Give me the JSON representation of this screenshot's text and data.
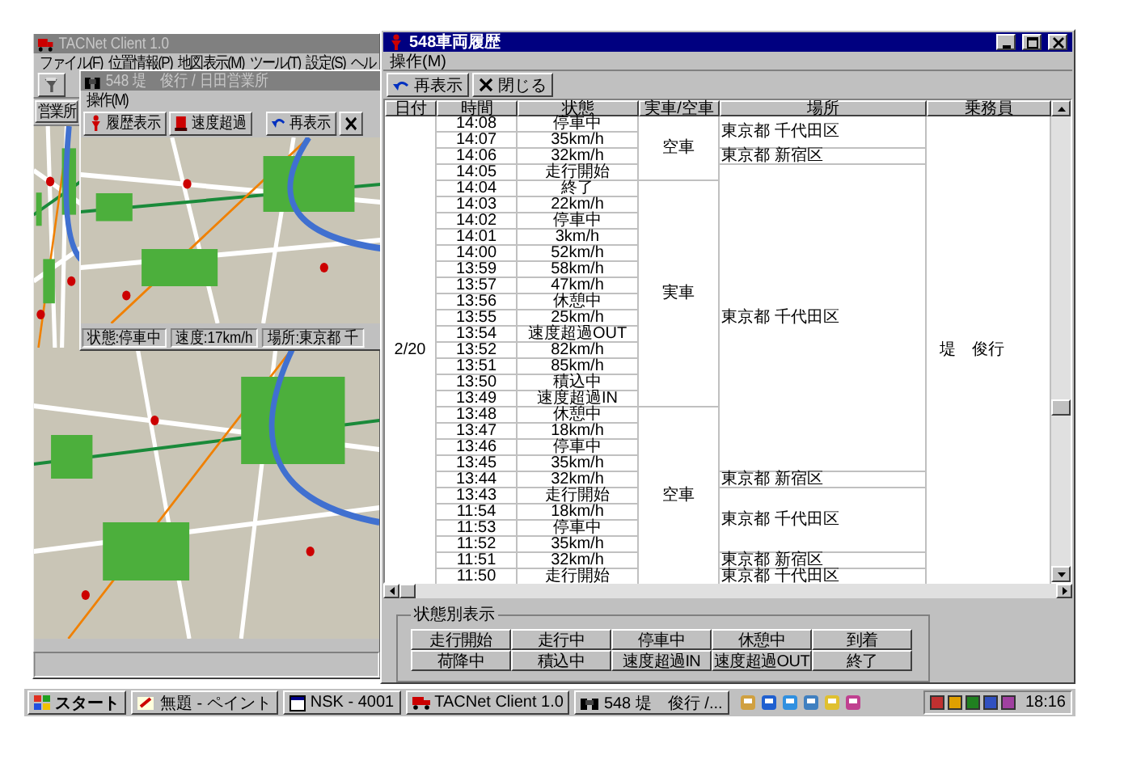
{
  "background_window": {
    "title": "TACNet Client 1.0",
    "menu": [
      "ファイル(F)",
      "位置情報(P)",
      "地図表示(M)",
      "ツール(T)",
      "設定(S)",
      "ヘル"
    ],
    "office_tab": "営業所",
    "vehicle_window": {
      "title": "548 堤　俊行 / 日田営業所",
      "menu": [
        "操作(M)"
      ],
      "toolbar": [
        {
          "kind": "history",
          "label": "履歴表示"
        },
        {
          "kind": "speed",
          "label": "速度超過"
        },
        {
          "kind": "refresh",
          "label": "再表示"
        },
        {
          "kind": "close"
        }
      ],
      "status_bar": [
        "状態:停車中",
        "速度:17km/h",
        "場所:東京都 千"
      ]
    }
  },
  "window": {
    "title": "548車両履歴",
    "menu": [
      "操作(M)"
    ],
    "toolbar": [
      {
        "kind": "refresh",
        "label": "再表示"
      },
      {
        "kind": "close",
        "label": "閉じる"
      }
    ]
  },
  "table": {
    "columns": [
      "日付",
      "時間",
      "状態",
      "実車/空車",
      "場所",
      "乗務員"
    ],
    "rows": [
      {
        "time": "14:08",
        "status": "停車中",
        "date": "2/20",
        "vehicle": "空車",
        "location": "東京都 千代田区",
        "crew": "堤　俊行"
      },
      {
        "time": "14:07",
        "status": "35km/h"
      },
      {
        "time": "14:06",
        "status": "32km/h",
        "location": "東京都 新宿区"
      },
      {
        "time": "14:05",
        "status": "走行開始",
        "location": "東京都 千代田区"
      },
      {
        "time": "14:04",
        "status": "終了",
        "vehicle": "実車"
      },
      {
        "time": "14:03",
        "status": "22km/h"
      },
      {
        "time": "14:02",
        "status": "停車中"
      },
      {
        "time": "14:01",
        "status": "3km/h"
      },
      {
        "time": "14:00",
        "status": "52km/h"
      },
      {
        "time": "13:59",
        "status": "58km/h"
      },
      {
        "time": "13:57",
        "status": "47km/h"
      },
      {
        "time": "13:56",
        "status": "休憩中"
      },
      {
        "time": "13:55",
        "status": "25km/h"
      },
      {
        "time": "13:54",
        "status": "速度超過OUT"
      },
      {
        "time": "13:52",
        "status": "82km/h"
      },
      {
        "time": "13:51",
        "status": "85km/h"
      },
      {
        "time": "13:50",
        "status": "積込中"
      },
      {
        "time": "13:49",
        "status": "速度超過IN"
      },
      {
        "time": "13:48",
        "status": "休憩中",
        "vehicle": "空車"
      },
      {
        "time": "13:47",
        "status": "18km/h"
      },
      {
        "time": "13:46",
        "status": "停車中"
      },
      {
        "time": "13:45",
        "status": "35km/h"
      },
      {
        "time": "13:44",
        "status": "32km/h",
        "location": "東京都 新宿区"
      },
      {
        "time": "13:43",
        "status": "走行開始",
        "location": "東京都 千代田区"
      },
      {
        "time": "11:54",
        "status": "18km/h"
      },
      {
        "time": "11:53",
        "status": "停車中"
      },
      {
        "time": "11:52",
        "status": "35km/h"
      },
      {
        "time": "11:51",
        "status": "32km/h",
        "location": "東京都 新宿区"
      },
      {
        "time": "11:50",
        "status": "走行開始",
        "location": "東京都 千代田区"
      }
    ]
  },
  "legend": {
    "title": "状態別表示",
    "buttons": [
      "走行開始",
      "走行中",
      "停車中",
      "休憩中",
      "到着",
      "荷降中",
      "積込中",
      "速度超過IN",
      "速度超過OUT",
      "終了"
    ]
  },
  "taskbar": {
    "start": "スタート",
    "tasks": [
      {
        "kind": "paint",
        "label": "無題 - ペイント"
      },
      {
        "kind": "window",
        "label": "NSK - 4001"
      },
      {
        "kind": "truck",
        "label": "TACNet Client 1.0"
      },
      {
        "kind": "binoculars",
        "label": "548 堤　俊行 /..."
      }
    ],
    "clock": "18:16"
  }
}
